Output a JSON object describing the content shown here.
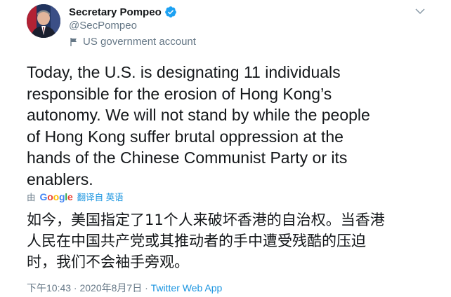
{
  "author": {
    "name": "Secretary Pompeo",
    "handle": "@SecPompeo",
    "label": "US government account"
  },
  "tweet": {
    "text_en": "Today, the U.S. is designating 11 individuals\nresponsible for the erosion of Hong Kong’s\nautonomy. We will not stand by while the people\nof Hong Kong suffer brutal oppression at the\nhands of the Chinese Communist Party or its\nenablers.",
    "translation": {
      "by": "由",
      "provider": "Google",
      "link": "翻译自 英语"
    },
    "text_zh": "如今，美国指定了11个人来破坏香港的自治权。当香港\n人民在中国共产党或其推动者的手中遭受残酷的压迫\n时，我们不会袖手旁观。",
    "timestamp": "下午10:43 · 2020年8月7日 · ",
    "client": "Twitter Web App"
  },
  "icons": {
    "verified": "verified-badge-icon",
    "government": "flag-icon",
    "menu": "chevron-down-icon"
  },
  "colors": {
    "accent": "#1da1f2",
    "link": "#1b95e0",
    "secondary_text": "#657786",
    "primary_text": "#14171a"
  }
}
